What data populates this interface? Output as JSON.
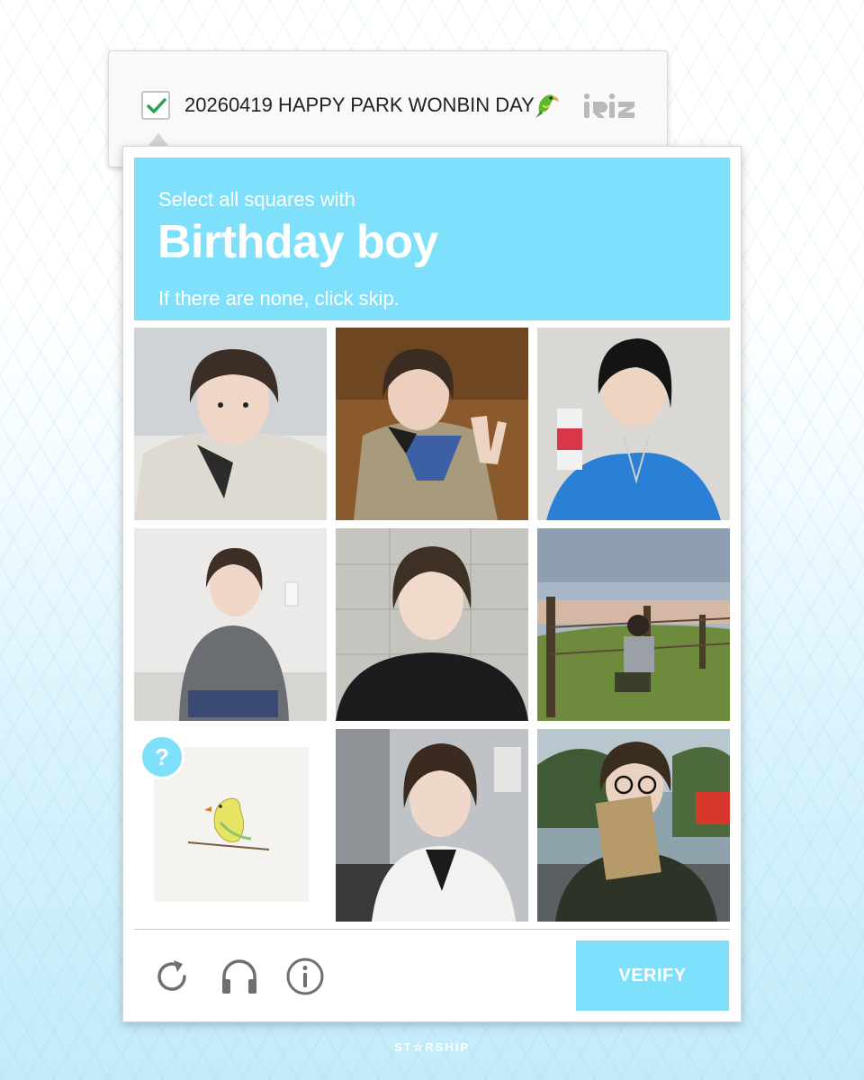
{
  "anchor": {
    "checked": true,
    "title": "20260419 HAPPY PARK WONBIN DAY",
    "emoji_icon": "parrot-icon",
    "logo_icon": "riize-logo-icon"
  },
  "challenge": {
    "instruction_prefix": "Select all squares with",
    "target": "Birthday boy",
    "note": "If there are none, click skip.",
    "tiles": [
      {
        "subject": "selfie-light-jacket"
      },
      {
        "subject": "selfie-peace-sign"
      },
      {
        "subject": "drinking-juice-box"
      },
      {
        "subject": "crouching-grey-sweater"
      },
      {
        "subject": "black-jacket-portrait"
      },
      {
        "subject": "hillside-fence-sky"
      },
      {
        "subject": "bird-drawing",
        "badge": "?"
      },
      {
        "subject": "white-coat-portrait"
      },
      {
        "subject": "glasses-holding-envelope"
      }
    ]
  },
  "footer": {
    "reload_icon": "reload-icon",
    "audio_icon": "headphones-icon",
    "info_icon": "info-icon",
    "verify_label": "VERIFY"
  },
  "brand": "ST☆RSHIP",
  "colors": {
    "accent": "#7ee0fa",
    "check": "#2e9e4f",
    "icon_grey": "#6f6f6f"
  }
}
